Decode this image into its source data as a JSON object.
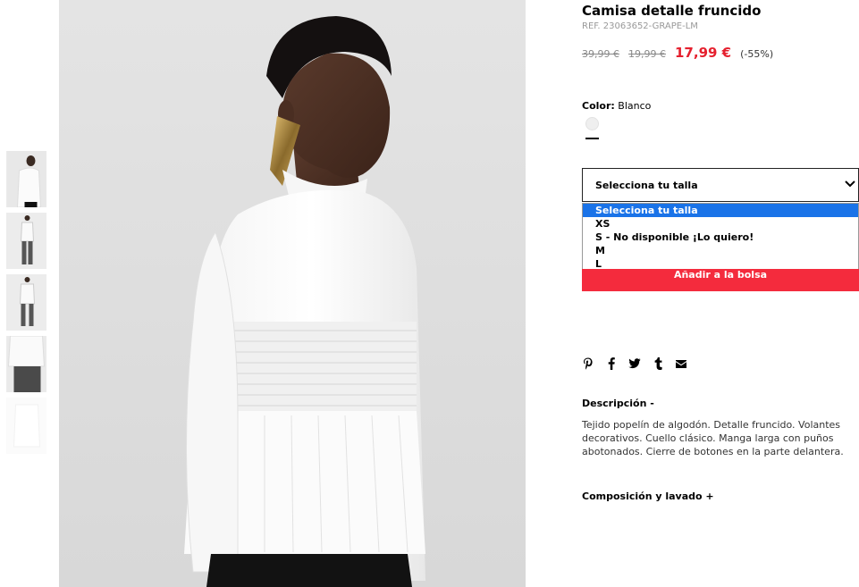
{
  "product": {
    "title": "Camisa detalle fruncido",
    "ref": "REF. 23063652-GRAPE-LM",
    "price_original": "39,99 €",
    "price_previous": "19,99 €",
    "price_sale": "17,99 €",
    "discount": "(-55%)"
  },
  "color": {
    "label": "Color:",
    "value": "Blanco",
    "swatch_hex": "#efefef"
  },
  "size": {
    "select_label": "Selecciona tu talla",
    "options": [
      "Selecciona tu talla",
      "XS",
      "S - No disponible ¡Lo quiero!",
      "M",
      "L"
    ],
    "selected_index": 0
  },
  "cart": {
    "add_label": "Añadir a la bolsa"
  },
  "share": {
    "icons": [
      "pinterest-icon",
      "facebook-icon",
      "twitter-icon",
      "tumblr-icon",
      "email-icon"
    ]
  },
  "description": {
    "heading": "Descripción -",
    "text": "Tejido popelín de algodón. Detalle fruncido. Volantes decorativos. Cuello clásico. Manga larga con puños abotonados. Cierre de botones en la parte delantera."
  },
  "composition": {
    "heading": "Composición y lavado +"
  },
  "colors": {
    "accent": "#f42b3d",
    "sale": "#e5202e",
    "selected_option": "#1a73e8"
  }
}
